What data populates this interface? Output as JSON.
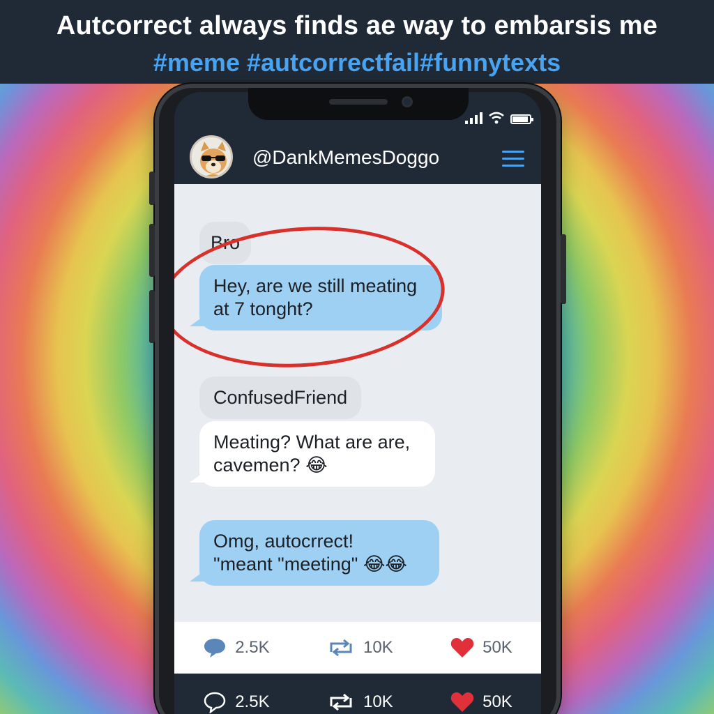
{
  "banner": {
    "title": "Autcorrect always finds ae way to embarsis me",
    "tags": "#meme #autcorrectfail#funnytexts"
  },
  "profile": {
    "handle": "@DankMemesDoggo",
    "avatar_icon": "dog-with-sunglasses-icon"
  },
  "messages": [
    {
      "sender_label": "Bro"
    },
    {
      "text_line1": "Hey, are we still meating",
      "text_line2": "at 7 tonght?"
    },
    {
      "sender_label": "ConfusedFriend"
    },
    {
      "text_line1": "Meating? What are are,",
      "text_line2": "cavemen? 😂"
    },
    {
      "text_line1": "Omg, autocrrect!",
      "text_line2": "\"meant \"meeting\" 😂😂"
    }
  ],
  "stats_light": {
    "comments": "2.5K",
    "retweets": "10K",
    "likes": "50K"
  },
  "stats_dark": {
    "comments": "2.5K",
    "retweets": "10K",
    "likes": "50K"
  },
  "colors": {
    "banner_bg": "#1f2a36",
    "hashtag": "#4aa3f0",
    "bubble_blue": "#9ed0f4",
    "highlight_circle": "#d8302a",
    "heart": "#e0303a"
  }
}
